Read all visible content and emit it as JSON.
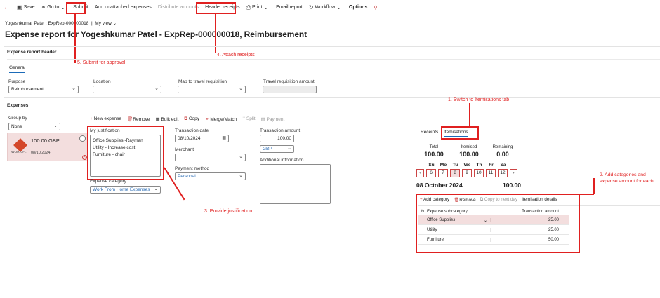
{
  "toolbar": {
    "back": "←",
    "save": "Save",
    "goto": "Go to",
    "submit": "Submit",
    "add_unattached": "Add unattached expenses",
    "distribute": "Distribute amounts",
    "header_receipts": "Header receipts",
    "print": "Print",
    "email": "Email report",
    "workflow": "Workflow",
    "options": "Options"
  },
  "breadcrumb": {
    "path": "Yogeshkumar Patel : ExpRep-000000018",
    "view": "My view"
  },
  "page_title": "Expense report for Yogeshkumar Patel - ExpRep-000000018, Reimbursement",
  "annotations": {
    "a1": "1. Switch to Itemisations tab",
    "a2": "2. Add categories and expense amount for each",
    "a3": "3. Provide justification",
    "a4": "4. Attach receipts",
    "a5": "5. Submit for approval"
  },
  "header_section": {
    "title": "Expense report header",
    "tab": "General",
    "purpose_label": "Purpose",
    "purpose_value": "Reimbursement",
    "location_label": "Location",
    "map_label": "Map to travel requisition",
    "travel_amount_label": "Travel requisition amount"
  },
  "expenses": {
    "title": "Expenses",
    "group_by_label": "Group by",
    "group_by_value": "None",
    "actions": {
      "new": "New expense",
      "remove": "Remove",
      "bulk": "Bulk edit",
      "copy": "Copy",
      "merge": "Merge/Match",
      "split": "Split",
      "payment": "Payment"
    },
    "card": {
      "amount": "100.00 GBP",
      "category": "WORK F...",
      "date": "08/10/2024"
    }
  },
  "form": {
    "justification_label": "My justification",
    "justification_lines": [
      "Office Supplies -Rayman",
      "Utility - Increase cost",
      "Furniture - chair"
    ],
    "category_label": "Expense category",
    "category_value": "Work From Home Expenses",
    "date_label": "Transaction date",
    "date_value": "08/10/2024",
    "merchant_label": "Merchant",
    "payment_label": "Payment method",
    "payment_value": "Personal",
    "amount_label": "Transaction amount",
    "amount_value": "100.00",
    "currency": "GBP",
    "info_label": "Additional information"
  },
  "right": {
    "tab_receipts": "Receipts",
    "tab_itemisations": "Itemisations",
    "total_label": "Total",
    "total_value": "100.00",
    "itemised_label": "Itemised",
    "itemised_value": "100.00",
    "remaining_label": "Remaining",
    "remaining_value": "0.00",
    "days": [
      "Su",
      "Mo",
      "Tu",
      "We",
      "Th",
      "Fr",
      "Sa"
    ],
    "dates": [
      "6",
      "7",
      "8",
      "9",
      "10",
      "11",
      "12"
    ],
    "selected_date": "08 October 2024",
    "selected_amount": "100.00",
    "actions": {
      "add": "Add category",
      "remove": "Remove",
      "copy": "Copy to next day",
      "details": "Itemisation details"
    },
    "col_sub": "Expense subcategory",
    "col_amount": "Transaction amount",
    "rows": [
      {
        "name": "Office Supplies",
        "amount": "25.00"
      },
      {
        "name": "Utility",
        "amount": "25.00"
      },
      {
        "name": "Furniture",
        "amount": "50.00"
      }
    ]
  }
}
